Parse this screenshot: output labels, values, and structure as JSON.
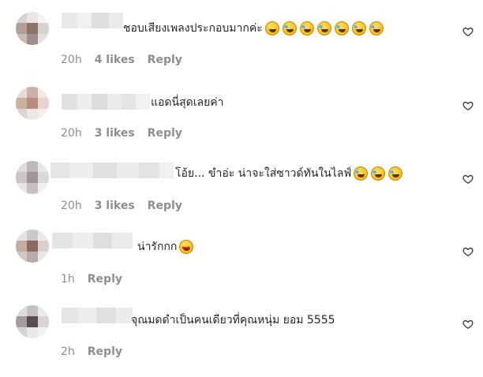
{
  "comments": [
    {
      "text": "ชอบเสียงเพลงประกอบมากค่ะ",
      "emojis": [
        "sweat-smile",
        "laugh",
        "laugh",
        "laugh",
        "laugh",
        "laugh",
        "laugh"
      ],
      "time": "20h",
      "likes": "4 likes",
      "reply": "Reply"
    },
    {
      "text": "แอดนี่สุดเลยค่า",
      "emojis": [],
      "time": "20h",
      "likes": "3 likes",
      "reply": "Reply"
    },
    {
      "text": "โอ้ย... ขำอ่ะ น่าจะใส่ซาวด์ทันในไลฟ์",
      "emojis": [
        "laugh",
        "laugh",
        "laugh"
      ],
      "time": "20h",
      "likes": "3 likes",
      "reply": "Reply"
    },
    {
      "text": "น่ารักกก",
      "emojis": [
        "heart-eyes"
      ],
      "time": "1h",
      "likes": "",
      "reply": "Reply"
    },
    {
      "text": "จุณมดดำเป็นคนเดียวที่คุณหนุ่ม ยอม 5555",
      "emojis": [],
      "time": "2h",
      "likes": "",
      "reply": "Reply"
    }
  ],
  "icons": {
    "like": "heart-outline-icon"
  },
  "colors": {
    "text": "#262626",
    "meta": "#8e8e8e"
  }
}
